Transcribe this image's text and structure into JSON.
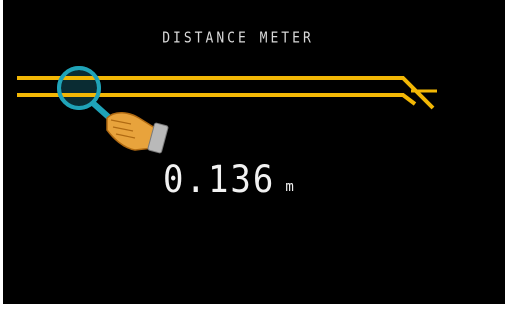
{
  "screen": {
    "title": "DISTANCE METER",
    "reading": {
      "value": "0.136",
      "unit": "m"
    }
  },
  "icons": {
    "rails": "rail-track",
    "magnifier": "magnifier-icon",
    "hand": "pointing-hand-icon"
  },
  "colors": {
    "background": "#000000",
    "rail": "#f2b705",
    "magnifier_ring": "#1fa3b8",
    "hand_skin": "#e8a33c",
    "sleeve": "#b9b9b9",
    "text": "#e6e6e6"
  }
}
